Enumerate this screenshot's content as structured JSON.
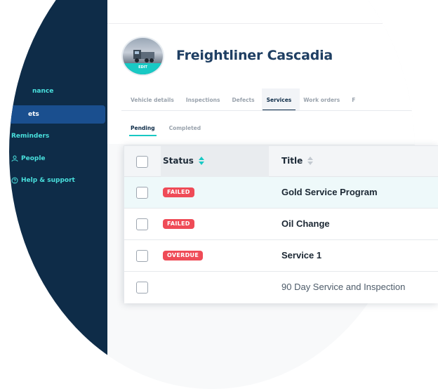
{
  "sidebar": {
    "items": [
      {
        "label": "Maintenance",
        "visible_label": "nance",
        "icon": "wrench-icon"
      },
      {
        "label": "Assets",
        "visible_label": "ets",
        "icon": "truck-icon",
        "active": true
      },
      {
        "label": "Reminders",
        "visible_label": "Reminders",
        "icon": "bell-icon"
      },
      {
        "label": "People",
        "visible_label": "People",
        "icon": "person-icon"
      },
      {
        "label": "Help & support",
        "visible_label": "Help & support",
        "icon": "help-circle-icon"
      }
    ]
  },
  "vehicle": {
    "title": "Freightliner Cascadia",
    "avatar_edit_label": "EDIT"
  },
  "tabs": [
    "Vehicle details",
    "Inspections",
    "Defects",
    "Services",
    "Work orders",
    "F"
  ],
  "active_tab": "Services",
  "subtabs": [
    "Pending",
    "Completed"
  ],
  "active_subtab": "Pending",
  "table": {
    "columns": [
      "Status",
      "Title"
    ],
    "sorted_column": "Status",
    "rows": [
      {
        "status": "FAILED",
        "title": "Gold Service Program",
        "highlighted": true
      },
      {
        "status": "FAILED",
        "title": "Oil Change"
      },
      {
        "status": "OVERDUE",
        "title": "Service 1"
      },
      {
        "status": "",
        "title": "90 Day Service and Inspection"
      }
    ]
  },
  "colors": {
    "sidebar_bg": "#0e2c48",
    "accent_teal": "#18c9c4",
    "badge_red": "#ef4b57",
    "title_navy": "#1f3f63"
  }
}
